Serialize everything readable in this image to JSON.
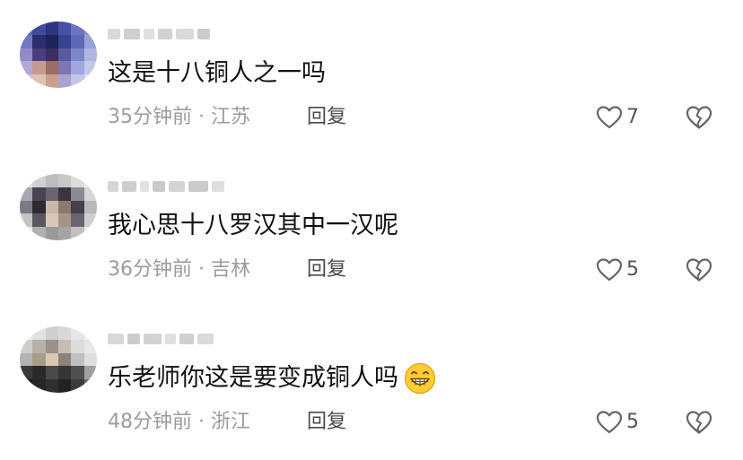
{
  "comments": [
    {
      "text": "这是十八铜人之一吗",
      "time": "35分钟前",
      "location": "江苏",
      "reply_label": "回复",
      "likes": "7"
    },
    {
      "text": "我心思十八罗汉其中一汉呢",
      "time": "36分钟前",
      "location": "吉林",
      "reply_label": "回复",
      "likes": "5"
    },
    {
      "text": "乐老师你这是要变成铜人吗",
      "time": "48分钟前",
      "location": "浙江",
      "reply_label": "回复",
      "likes": "5"
    }
  ],
  "separator": " · ",
  "icons": {
    "like": "heart-outline-icon",
    "dislike": "broken-heart-icon",
    "emoji": "grinning-face-emoji"
  },
  "colors": {
    "text": "#111111",
    "meta": "#9b9b9b",
    "reply": "#4a4a4a",
    "icon": "#666666"
  }
}
